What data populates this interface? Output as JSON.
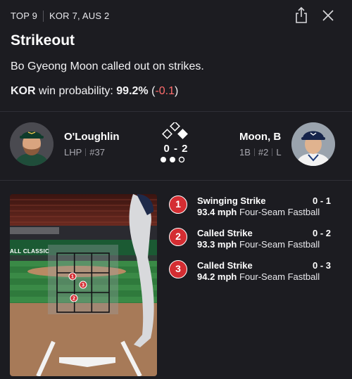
{
  "header": {
    "inning": "TOP 9",
    "score": "KOR 7, AUS 2"
  },
  "event": {
    "title": "Strikeout",
    "description": "Bo Gyeong Moon called out on strikes.",
    "win_team": "KOR",
    "win_label": " win probability: ",
    "win_pct": "99.2%",
    "win_delta_open": " (",
    "win_delta": "-0.1",
    "win_delta_close": ")"
  },
  "matchup": {
    "pitcher": {
      "name": "O'Loughlin",
      "position": "LHP",
      "number": "#37"
    },
    "batter": {
      "name": "Moon, B",
      "position": "1B",
      "number": "#2",
      "bats": "L"
    },
    "count": "0 - 2",
    "bases": {
      "first": true,
      "second": false,
      "third": false
    },
    "outs": 2
  },
  "zone": {
    "label": "ALL CLASSIC"
  },
  "pitches": [
    {
      "num": "1",
      "result": "Swinging Strike",
      "count": "0 - 1",
      "speed": "93.4 mph",
      "type": "Four-Seam Fastball"
    },
    {
      "num": "2",
      "result": "Called Strike",
      "count": "0 - 2",
      "speed": "93.3 mph",
      "type": "Four-Seam Fastball"
    },
    {
      "num": "3",
      "result": "Called Strike",
      "count": "0 - 3",
      "speed": "94.2 mph",
      "type": "Four-Seam Fastball"
    }
  ],
  "colors": {
    "strike_marker": "#d42d32",
    "negative_delta": "#ff6d6d",
    "background": "#1c1c21"
  }
}
